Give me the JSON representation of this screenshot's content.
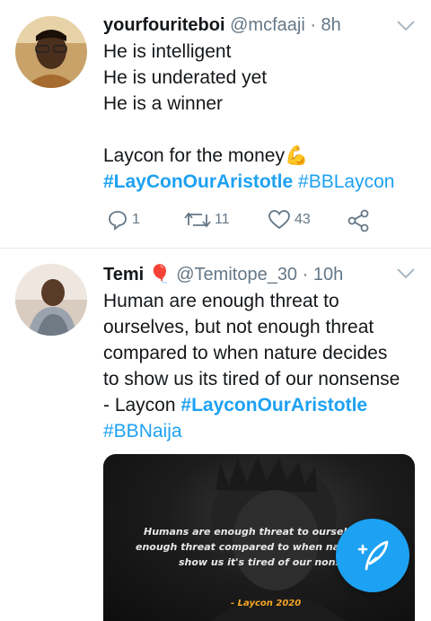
{
  "tweets": [
    {
      "display_name": "yourfouriteboi",
      "handle": "@mcfaaji",
      "time": "· 8h",
      "lines": [
        "He is intelligent",
        "He is underated yet",
        "He is a winner",
        "",
        "Laycon for the money💪"
      ],
      "hashtag_line": [
        "#LayConOurAristotle",
        "#BBLaycon"
      ],
      "replies": "1",
      "retweets": "11",
      "likes": "43",
      "avatar_icon": "profile-photo"
    },
    {
      "display_name": "Temi",
      "name_emoji": "🎈",
      "handle": "@Temitope_30",
      "time": "· 10h",
      "lines": [
        "Human are enough threat to",
        "ourselves, but not enough threat",
        "compared to when nature decides",
        "to show us its tired of our nonsense"
      ],
      "last_line_prefix": "- Laycon ",
      "hashtag_1": "#LayconOurAristotle",
      "hashtag_2": "#BBNaija",
      "avatar_icon": "profile-photo",
      "media": {
        "quote_lines": [
          "Humans are enough threat to ourselves, b",
          "enough threat compared to when nature ",
          "show us it's tired of our nonsens"
        ],
        "credit": "- Laycon 2020"
      }
    }
  ],
  "fab": {
    "icon": "compose-tweet-icon"
  },
  "colors": {
    "accent": "#1da1f2",
    "text": "#14171a",
    "muted": "#657786",
    "divider": "#e1e8ed"
  }
}
